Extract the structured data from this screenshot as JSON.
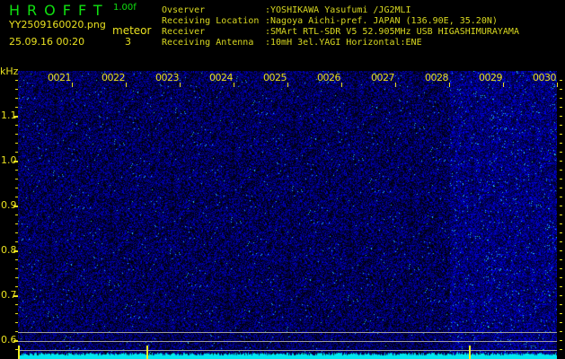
{
  "header": {
    "logo": "HROFFT",
    "version": "1.00f",
    "filename": "YY2509160020.png",
    "datetime": "25.09.16 00:20",
    "meteor_label": "meteor",
    "meteor_count": "3",
    "info": [
      {
        "label": "Ovserver",
        "value": ":YOSHIKAWA Yasufumi /JG2MLI"
      },
      {
        "label": "Receiving Location",
        "value": ":Nagoya Aichi-pref. JAPAN (136.90E, 35.20N)"
      },
      {
        "label": "Receiver",
        "value": ":SMArt RTL-SDR V5 52.905MHz USB HIGASHIMURAYAMA"
      },
      {
        "label": "Receiving Antenna",
        "value": ":10mH 3el.YAGI Horizontal:ENE"
      }
    ]
  },
  "spectrogram": {
    "y_unit": "kHz",
    "y_ticks": [
      "1.1",
      "1.0",
      "0.9",
      "0.8",
      "0.7",
      "0.6"
    ],
    "time_labels": [
      "0021",
      "0022",
      "0023",
      "0024",
      "0025",
      "0026",
      "0027",
      "0028",
      "0029",
      "0030"
    ],
    "colors": {
      "background": "#000000",
      "noise": "#1020c0",
      "text": "#e8e020",
      "level": "#00e8f0"
    }
  }
}
